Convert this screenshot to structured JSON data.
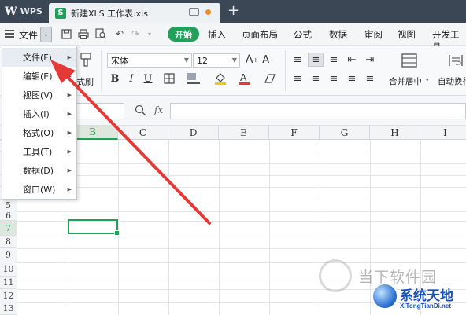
{
  "titlebar": {
    "app_label": "WPS",
    "tab_title": "新建XLS 工作表.xls",
    "new_tab_symbol": "+"
  },
  "menubar": {
    "file_label": "文件",
    "start_button": "开始",
    "items": [
      "插入",
      "页面布局",
      "公式",
      "数据",
      "审阅",
      "视图",
      "开发工具"
    ]
  },
  "ribbon": {
    "format_painter_label": "式刷",
    "font_name": "宋体",
    "font_size": "12",
    "merge_label": "合并居中",
    "autowrap_label": "自动换行"
  },
  "formula_bar": {
    "fx_label": "fx",
    "value": ""
  },
  "grid": {
    "columns": [
      "B",
      "C",
      "D",
      "E",
      "F",
      "G",
      "H",
      "I"
    ],
    "selected_column": "B",
    "rows": [
      "5",
      "6",
      "7",
      "8",
      "9",
      "10",
      "11",
      "12",
      "13"
    ],
    "selected_row": "7"
  },
  "file_menu": {
    "items": [
      {
        "label": "文件(F)"
      },
      {
        "label": "编辑(E)"
      },
      {
        "label": "视图(V)"
      },
      {
        "label": "插入(I)"
      },
      {
        "label": "格式(O)"
      },
      {
        "label": "工具(T)"
      },
      {
        "label": "数据(D)"
      },
      {
        "label": "窗口(W)"
      }
    ]
  },
  "watermark": {
    "text": "当下软件园",
    "brand_name": "系统天地",
    "brand_url": "XiTongTianDi.net"
  },
  "colors": {
    "accent_green": "#1fa15a",
    "titlebar_bg": "#3b4755",
    "arrow_red": "#e53935"
  }
}
